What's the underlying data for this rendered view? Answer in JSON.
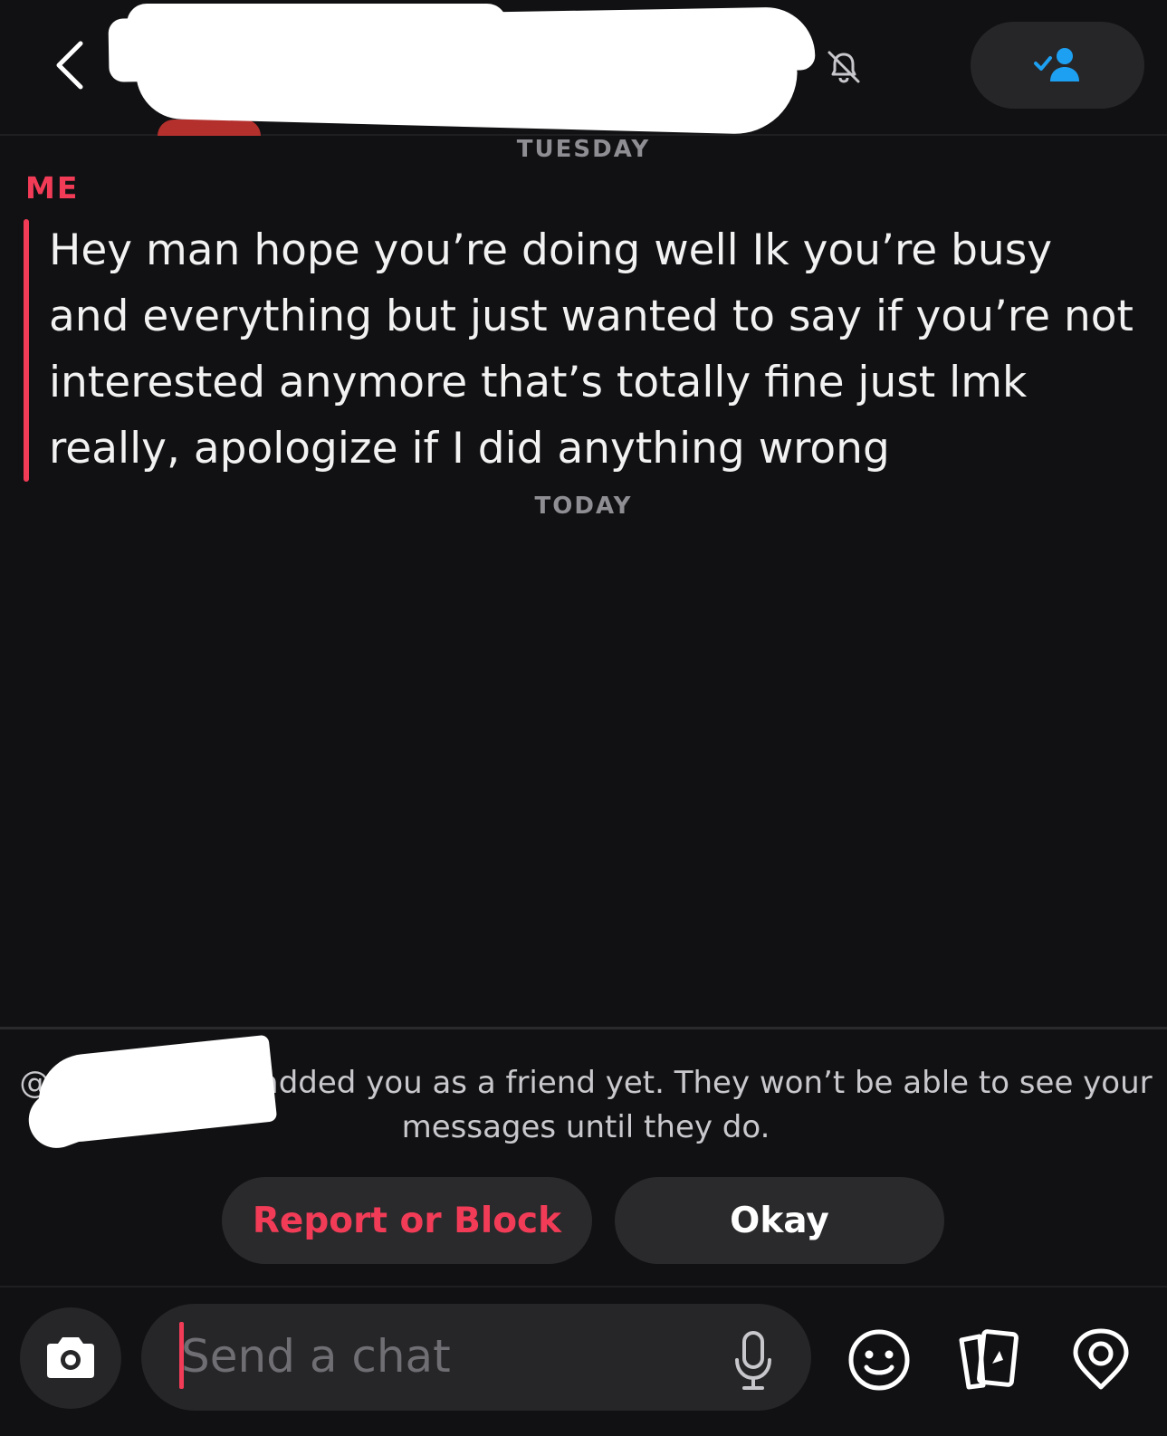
{
  "header": {
    "back_icon": "chevron-left-icon",
    "mute_icon": "bell-off-icon",
    "friend_button_icon": "friend-added-icon",
    "accent_color": "#1ea0f2"
  },
  "conversation": {
    "day_labels": [
      "TUESDAY",
      "TODAY"
    ],
    "messages": [
      {
        "sender": "ME",
        "text": "Hey man hope you’re doing well Ik you’re busy and everything but just wanted to say if you’re not interested anymore that’s totally fine just lmk really, apologize if I did anything wrong",
        "color": "#f23c57"
      }
    ]
  },
  "notice": {
    "text": "@A                 elli has not added you as a friend yet. They won’t be able to see your messages until they do.",
    "report_label": "Report or Block",
    "okay_label": "Okay"
  },
  "composer": {
    "placeholder": "Send a chat",
    "icons": [
      "camera-icon",
      "microphone-icon",
      "emoji-icon",
      "cards-icon",
      "location-icon"
    ]
  }
}
